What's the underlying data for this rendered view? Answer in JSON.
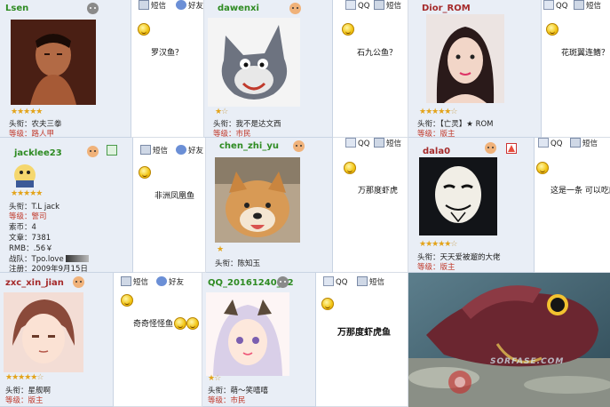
{
  "toolbar": {
    "sms": "短信",
    "friend": "好友",
    "qq": "QQ"
  },
  "tiles": [
    {
      "username": "Lsen",
      "lines": [
        {
          "label": "头衔：",
          "value": "农夫三拳"
        },
        {
          "label": "等级：",
          "value": "路人甲"
        }
      ],
      "message": "罗汉鱼？"
    },
    {
      "username": "dawenxi",
      "lines": [
        {
          "label": "头衔：",
          "value": "我不是达文西"
        },
        {
          "label": "等级：",
          "value": "市民"
        }
      ],
      "message": "石九公鱼？"
    },
    {
      "username": "Dior_ROM",
      "lines": [
        {
          "label": "头衔：",
          "value": "【亡灵】★ ROM"
        },
        {
          "label": "等级：",
          "value": "版主"
        }
      ],
      "message": "花斑翼连鳍？"
    },
    {
      "username": "jacklee23",
      "lines": [
        {
          "label": "头衔：",
          "value": "T.L jack"
        },
        {
          "label": "等级：",
          "value": "警司"
        },
        {
          "label": "索币：",
          "value": "4"
        },
        {
          "label": "文章：",
          "value": "7381"
        },
        {
          "label": "RMB：",
          "value": ".56￥"
        },
        {
          "label": "战队：",
          "value": "Tpo.love"
        },
        {
          "label": "注册：",
          "value": "2009年9月15日"
        }
      ],
      "message": "非洲凤凰鱼"
    },
    {
      "username": "chen_zhi_yu",
      "lines": [
        {
          "label": "头衔：",
          "value": "陈知玉"
        }
      ],
      "message": "万那度虾虎"
    },
    {
      "username": "dala0",
      "lines": [
        {
          "label": "头衔：",
          "value": "天天爱被遛的大佬"
        },
        {
          "label": "等级：",
          "value": "版主"
        }
      ],
      "message": "这是一条 可以吃的"
    },
    {
      "username": "zxc_xin_jian",
      "lines": [
        {
          "label": "头衔：",
          "value": "星舰啊"
        },
        {
          "label": "等级：",
          "value": "版主"
        }
      ],
      "message": "奇奇怪怪鱼"
    },
    {
      "username": "QQ_20161240_72",
      "lines": [
        {
          "label": "头衔：",
          "value": "萌～笑嘻嘻"
        },
        {
          "label": "等级：",
          "value": "市民"
        }
      ],
      "message": "万那度虾虎鱼"
    }
  ],
  "watermark": "SORFASE.COM",
  "colors": {
    "username": "#2e8b22",
    "level": "#c0392b",
    "star": "#e3a319",
    "panel": "#e9eef6"
  }
}
